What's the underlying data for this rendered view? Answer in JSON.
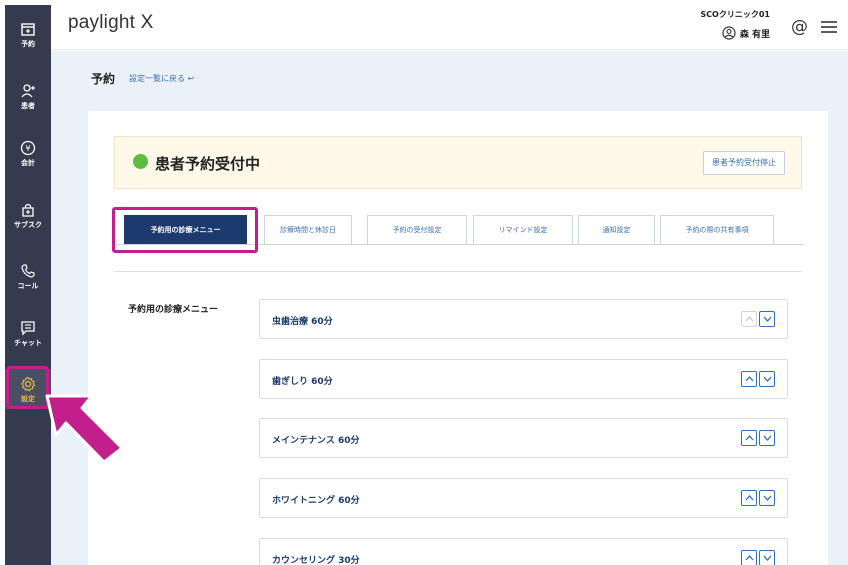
{
  "sidebar": {
    "items": [
      {
        "label": "予約",
        "icon": "calendar-plus-icon"
      },
      {
        "label": "患者",
        "icon": "user-add-icon"
      },
      {
        "label": "会計",
        "icon": "yen-icon"
      },
      {
        "label": "サブスク",
        "icon": "bag-plus-icon"
      },
      {
        "label": "コール",
        "icon": "phone-icon"
      },
      {
        "label": "チャット",
        "icon": "chat-icon"
      },
      {
        "label": "設定",
        "icon": "gear-icon"
      }
    ]
  },
  "header": {
    "logo": "paylight X",
    "clinic": "SCOクリニック01",
    "user": "森 有里"
  },
  "page": {
    "title": "予約",
    "back_link": "設定一覧に戻る ↩"
  },
  "status": {
    "text": "患者予約受付中",
    "stop_button": "患者予約受付停止"
  },
  "tabs": [
    "予約用の診療メニュー",
    "診療時間と休診日",
    "予約の受付設定",
    "リマインド設定",
    "通知設定",
    "予約の際の共有事項"
  ],
  "section_label": "予約用の診療メニュー",
  "menus": [
    "虫歯治療  60分",
    "歯ぎしり  60分",
    "メインテナンス  60分",
    "ホワイトニング  60分",
    "カウンセリング  30分"
  ],
  "colors": {
    "sidebar": "#353a4f",
    "accent_navy": "#1c3a6d",
    "highlight": "#c21e8c",
    "status_green": "#5bbd3f"
  }
}
